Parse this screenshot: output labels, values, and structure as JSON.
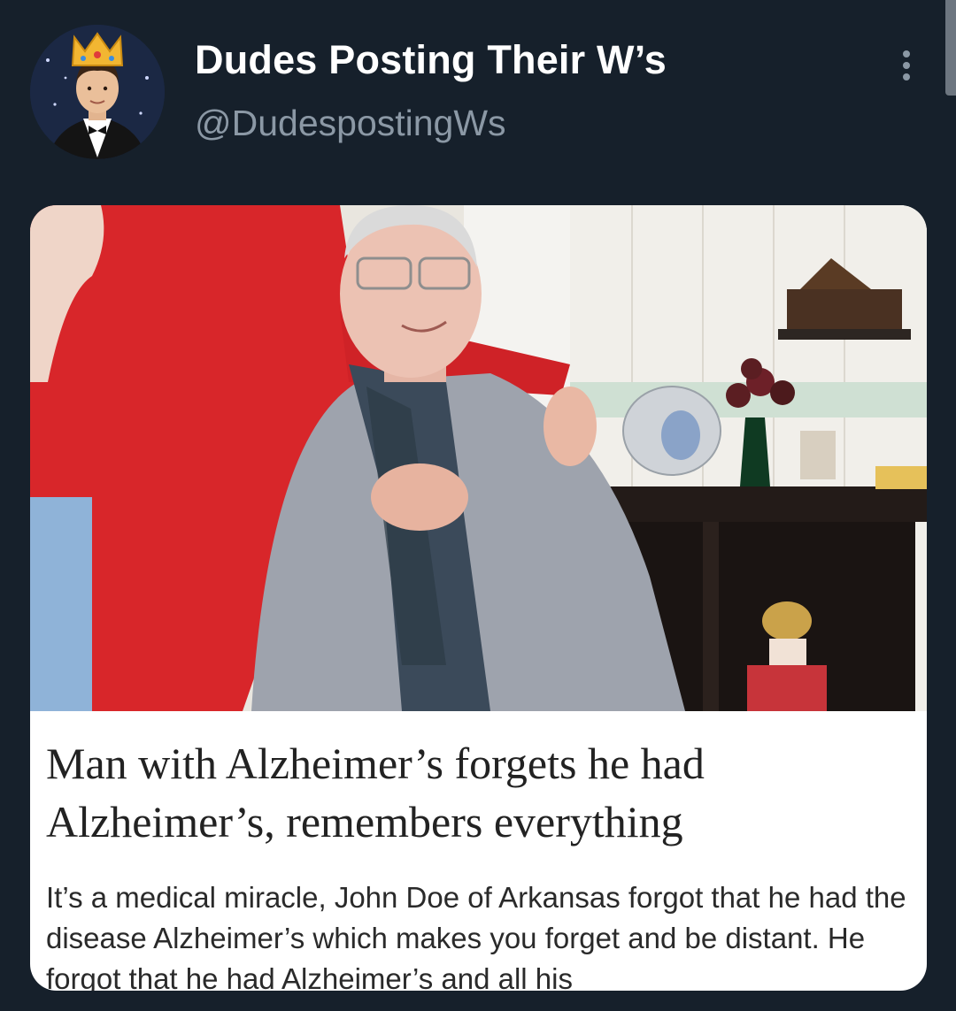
{
  "tweet": {
    "author": {
      "display_name": "Dudes Posting Their W’s",
      "handle": "@DudespostingWs",
      "avatar_icon": "crowned-man-avatar"
    },
    "more_icon": "more-vertical-icon",
    "media": {
      "photo_icon": "elderly-man-photo",
      "headline": "Man with Alzheimer’s forgets he had Alzheimer’s, remembers everything",
      "excerpt": "It’s a medical miracle, John Doe of Arkansas forgot that he had the disease Alzheimer’s which makes you forget and be distant. He forgot that he had Alzheimer’s and all his"
    }
  },
  "colors": {
    "background": "#16202b",
    "name": "#ffffff",
    "handle": "#8b98a5",
    "card": "#ffffff"
  }
}
